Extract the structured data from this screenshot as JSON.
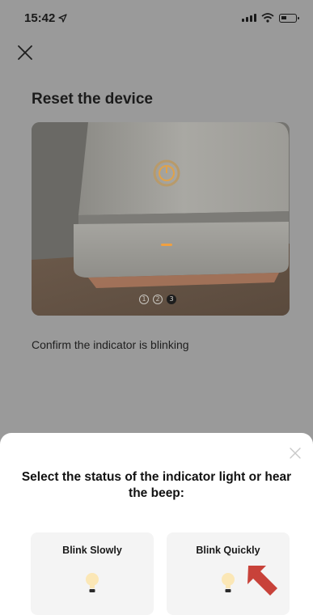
{
  "status_bar": {
    "time": "15:42",
    "location_icon": "location-arrow-icon",
    "signal_icon": "signal-bars-icon",
    "wifi_icon": "wifi-icon",
    "battery_icon": "battery-low-icon"
  },
  "header": {
    "close_icon": "close-icon"
  },
  "main": {
    "title": "Reset the device",
    "pager": [
      "1",
      "2",
      "3"
    ],
    "pager_active": 3,
    "instruction": "Confirm the indicator is blinking"
  },
  "sheet": {
    "close_icon": "close-icon",
    "title": "Select the status of the indicator light or hear the beep:",
    "options": [
      {
        "label": "Blink Slowly",
        "icon": "bulb-icon"
      },
      {
        "label": "Blink Quickly",
        "icon": "bulb-icon"
      }
    ]
  },
  "annotation": {
    "icon": "red-arrow-icon",
    "color": "#c8423a"
  },
  "colors": {
    "overlay": "#9a9a9a",
    "sheet_bg": "#ffffff",
    "option_bg": "#f4f4f4",
    "indicator_orange": "#f0a040"
  }
}
